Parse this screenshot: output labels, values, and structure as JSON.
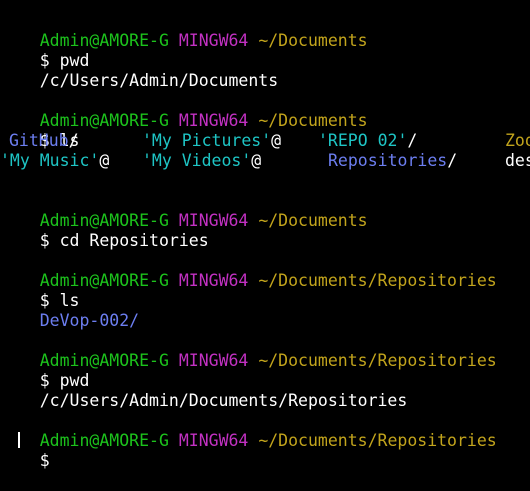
{
  "colors": {
    "background": "#000000",
    "user_host": "#1cc21c",
    "mingw": "#c231c2",
    "path": "#c2a41c",
    "directory": "#6c7ef0",
    "quoted_dir": "#1ec5c5",
    "text": "#ffffff"
  },
  "prompt": {
    "user_host": "Admin@AMORE-G",
    "system": "MINGW64",
    "path_documents": "~/Documents",
    "path_repositories": "~/Documents/Repositories",
    "symbol": "$"
  },
  "commands": {
    "pwd": "pwd",
    "ls": "ls",
    "cd": "cd Repositories"
  },
  "outputs": {
    "pwd_documents": "/c/Users/Admin/Documents",
    "pwd_repositories": "/c/Users/Admin/Documents/Repositories",
    "ls_repositories": "DeVop-002/"
  },
  "ls_documents": {
    "row1": [
      {
        "name": "GitHub",
        "suffix": "/"
      },
      {
        "name": "'My Pictures'",
        "suffix": "@"
      },
      {
        "name": "'REPO 02'",
        "suffix": "/"
      },
      {
        "name": "Zoo",
        "suffix": ""
      }
    ],
    "row2": [
      {
        "name": "'My Music'",
        "suffix": "@"
      },
      {
        "name": "'My Videos'",
        "suffix": "@"
      },
      {
        "name": "Repositories",
        "suffix": "/"
      },
      {
        "name": "des",
        "suffix": ""
      }
    ]
  }
}
